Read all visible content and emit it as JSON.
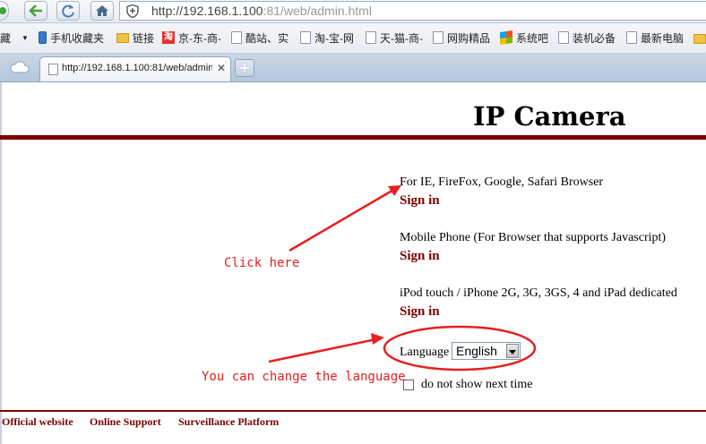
{
  "browser": {
    "url_host": "http://192.168.1.100",
    "url_rest": ":81/web/admin.html",
    "tab_title": "http://192.168.1.100:81/web/admin.html",
    "tab_close": "✕",
    "new_tab": "+",
    "bookmarks": [
      {
        "label": "藏",
        "icon": "none"
      },
      {
        "label": "手机收藏夹",
        "icon": "phone-icon"
      },
      {
        "label": "链接",
        "icon": "folder-icon"
      },
      {
        "label": "京-东-商-",
        "icon": "taobao-icon"
      },
      {
        "label": "酷站、实",
        "icon": "page-icon"
      },
      {
        "label": "淘-宝-网",
        "icon": "page-icon"
      },
      {
        "label": "天-猫-商-",
        "icon": "page-icon"
      },
      {
        "label": "网购精品",
        "icon": "page-icon"
      },
      {
        "label": "系统吧",
        "icon": "windows-icon"
      },
      {
        "label": "装机必备",
        "icon": "page-icon"
      },
      {
        "label": "最新电脑",
        "icon": "page-icon"
      }
    ]
  },
  "page": {
    "title": "IP Camera",
    "sections": [
      {
        "text": "For IE, FireFox, Google, Safari Browser",
        "link": "Sign in"
      },
      {
        "text": "Mobile Phone (For Browser that supports Javascript)",
        "link": "Sign in"
      },
      {
        "text": "iPod touch / iPhone 2G, 3G, 3GS, 4 and iPad dedicated",
        "link": "Sign in"
      }
    ],
    "language_label": "Language",
    "language_value": "English",
    "dont_show_label": "do not show next time",
    "dont_show_checked": false,
    "footer_links": [
      "Official website",
      "Online Support",
      "Surveillance Platform"
    ]
  },
  "annotations": {
    "click_here": "Click here",
    "change_language": "You can change the language",
    "color": "#e52020"
  },
  "colors": {
    "brand": "#7a0000",
    "tab_bar": "#b4c7dc"
  }
}
